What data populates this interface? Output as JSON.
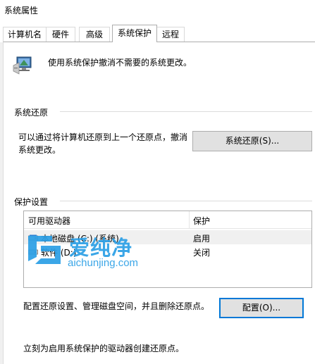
{
  "window": {
    "title": "系统属性"
  },
  "tabs": [
    {
      "label": "计算机名"
    },
    {
      "label": "硬件"
    },
    {
      "label": "高级"
    },
    {
      "label": "系统保护"
    },
    {
      "label": "远程"
    }
  ],
  "intro": {
    "text": "使用系统保护撤消不需要的系统更改。"
  },
  "restore": {
    "group_label": "系统还原",
    "description_line1": "可以通过将计算机还原到上一个还原点，撤消",
    "description_line2": "系统更改。",
    "button_label": "系统还原(S)..."
  },
  "protection": {
    "group_label": "保护设置",
    "columns": [
      "可用驱动器",
      "保护"
    ],
    "rows": [
      {
        "drive": "本地磁盘 (C:) (系统)",
        "status": "启用"
      },
      {
        "drive": "软件 (D:)",
        "status": "关闭"
      }
    ],
    "configure_text": "配置还原设置、管理磁盘空间，并且删除还原点。",
    "configure_button": "配置(O)...",
    "create_text": "立刻为启用系统保护的驱动器创建还原点。"
  },
  "watermark": {
    "brand": "爱纯净",
    "url": "aichunjing.com"
  },
  "colors": {
    "accent": "#0078d7",
    "watermark": "#2b9fe6",
    "button_face": "#e1e1e1"
  }
}
